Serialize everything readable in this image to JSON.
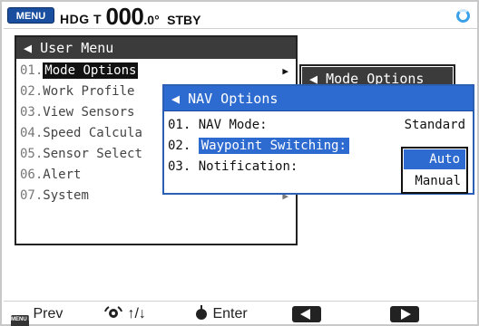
{
  "status": {
    "menu_badge": "MENU",
    "hdg_label": "HDG T",
    "heading_value": "000",
    "heading_decimal": ".0°",
    "mode": "STBY"
  },
  "user_menu": {
    "title": "User Menu",
    "items": [
      {
        "num": "01.",
        "label": "Mode Options",
        "arrow": "▶"
      },
      {
        "num": "02.",
        "label": "Work Profile",
        "arrow": ""
      },
      {
        "num": "03.",
        "label": "View Sensors",
        "arrow": ""
      },
      {
        "num": "04.",
        "label": "Speed Calcula",
        "arrow": ""
      },
      {
        "num": "05.",
        "label": "Sensor Select",
        "arrow": ""
      },
      {
        "num": "06.",
        "label": "Alert",
        "arrow": "▶"
      },
      {
        "num": "07.",
        "label": "System",
        "arrow": "▶"
      }
    ]
  },
  "mode_menu": {
    "title": "Mode Options"
  },
  "nav_menu": {
    "title": "NAV Options",
    "items": [
      {
        "num": "01.",
        "label": "NAV Mode:",
        "value": "Standard"
      },
      {
        "num": "02.",
        "label": "Waypoint Switching:",
        "value": ""
      },
      {
        "num": "03.",
        "label": "Notification:",
        "value": ""
      }
    ]
  },
  "dropdown": {
    "options": [
      "Auto",
      "Manual"
    ],
    "selected": "Auto"
  },
  "bottom": {
    "menu_esc_key": "MENU ESC",
    "prev": "Prev",
    "arrows": "↑/↓",
    "enter": "Enter"
  },
  "colors": {
    "accent": "#2e6bd0",
    "menu_title": "#3b3b3b",
    "status_icon": "#3aa0e8"
  }
}
